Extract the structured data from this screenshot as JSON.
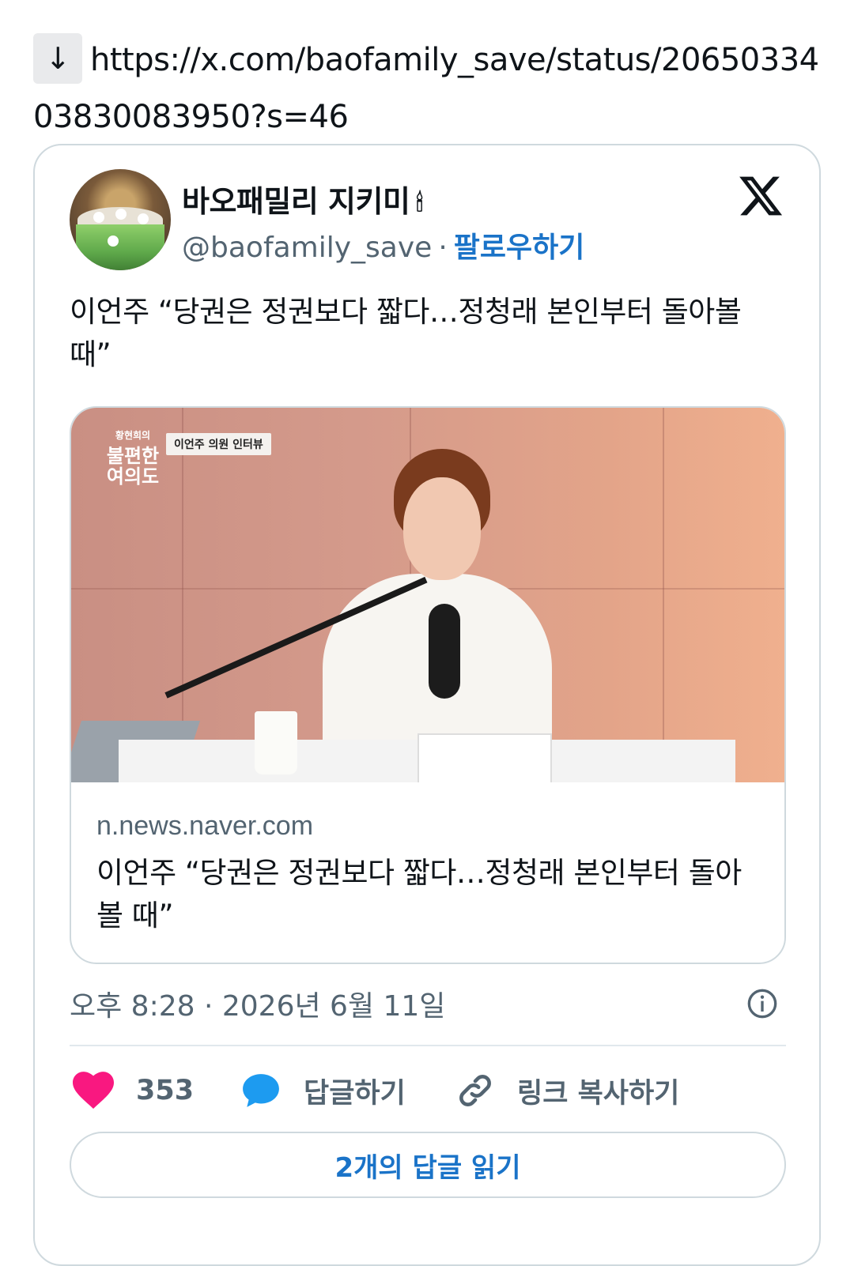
{
  "url": {
    "arrow": "↓",
    "text": "https://x.com/baofamily_save/status/2065033403830083950?s=46"
  },
  "tweet": {
    "display_name": "바오패밀리 지키미",
    "name_emoji": "🕯",
    "handle": "@baofamily_save",
    "separator": "·",
    "follow_label": "팔로우하기",
    "text": "이언주 “당권은 정권보다 짧다…정청래 본인부터 돌아볼 때”",
    "timestamp": "오후 8:28 · 2026년 6월 11일"
  },
  "link_card": {
    "show_logo_small": "황현희의",
    "show_logo_line1": "불편한",
    "show_logo_line2": "여의도",
    "show_tag": "이언주 의원 인터뷰",
    "domain": "n.news.naver.com",
    "title": "이언주 “당권은 정권보다 짧다…정청래 본인부터 돌아볼 때”"
  },
  "actions": {
    "like_count": "353",
    "reply_label": "답글하기",
    "copy_link_label": "링크 복사하기"
  },
  "read_replies_label": "2개의 답글 읽기",
  "colors": {
    "like": "#f91880",
    "reply": "#1d9bf0",
    "follow": "#1a73c8",
    "secondary_text": "#536471",
    "border": "#cfd9de"
  },
  "icons": {
    "x_logo": "x-logo-icon",
    "info": "info-icon",
    "heart": "heart-icon",
    "reply": "speech-bubble-icon",
    "link": "link-icon"
  }
}
